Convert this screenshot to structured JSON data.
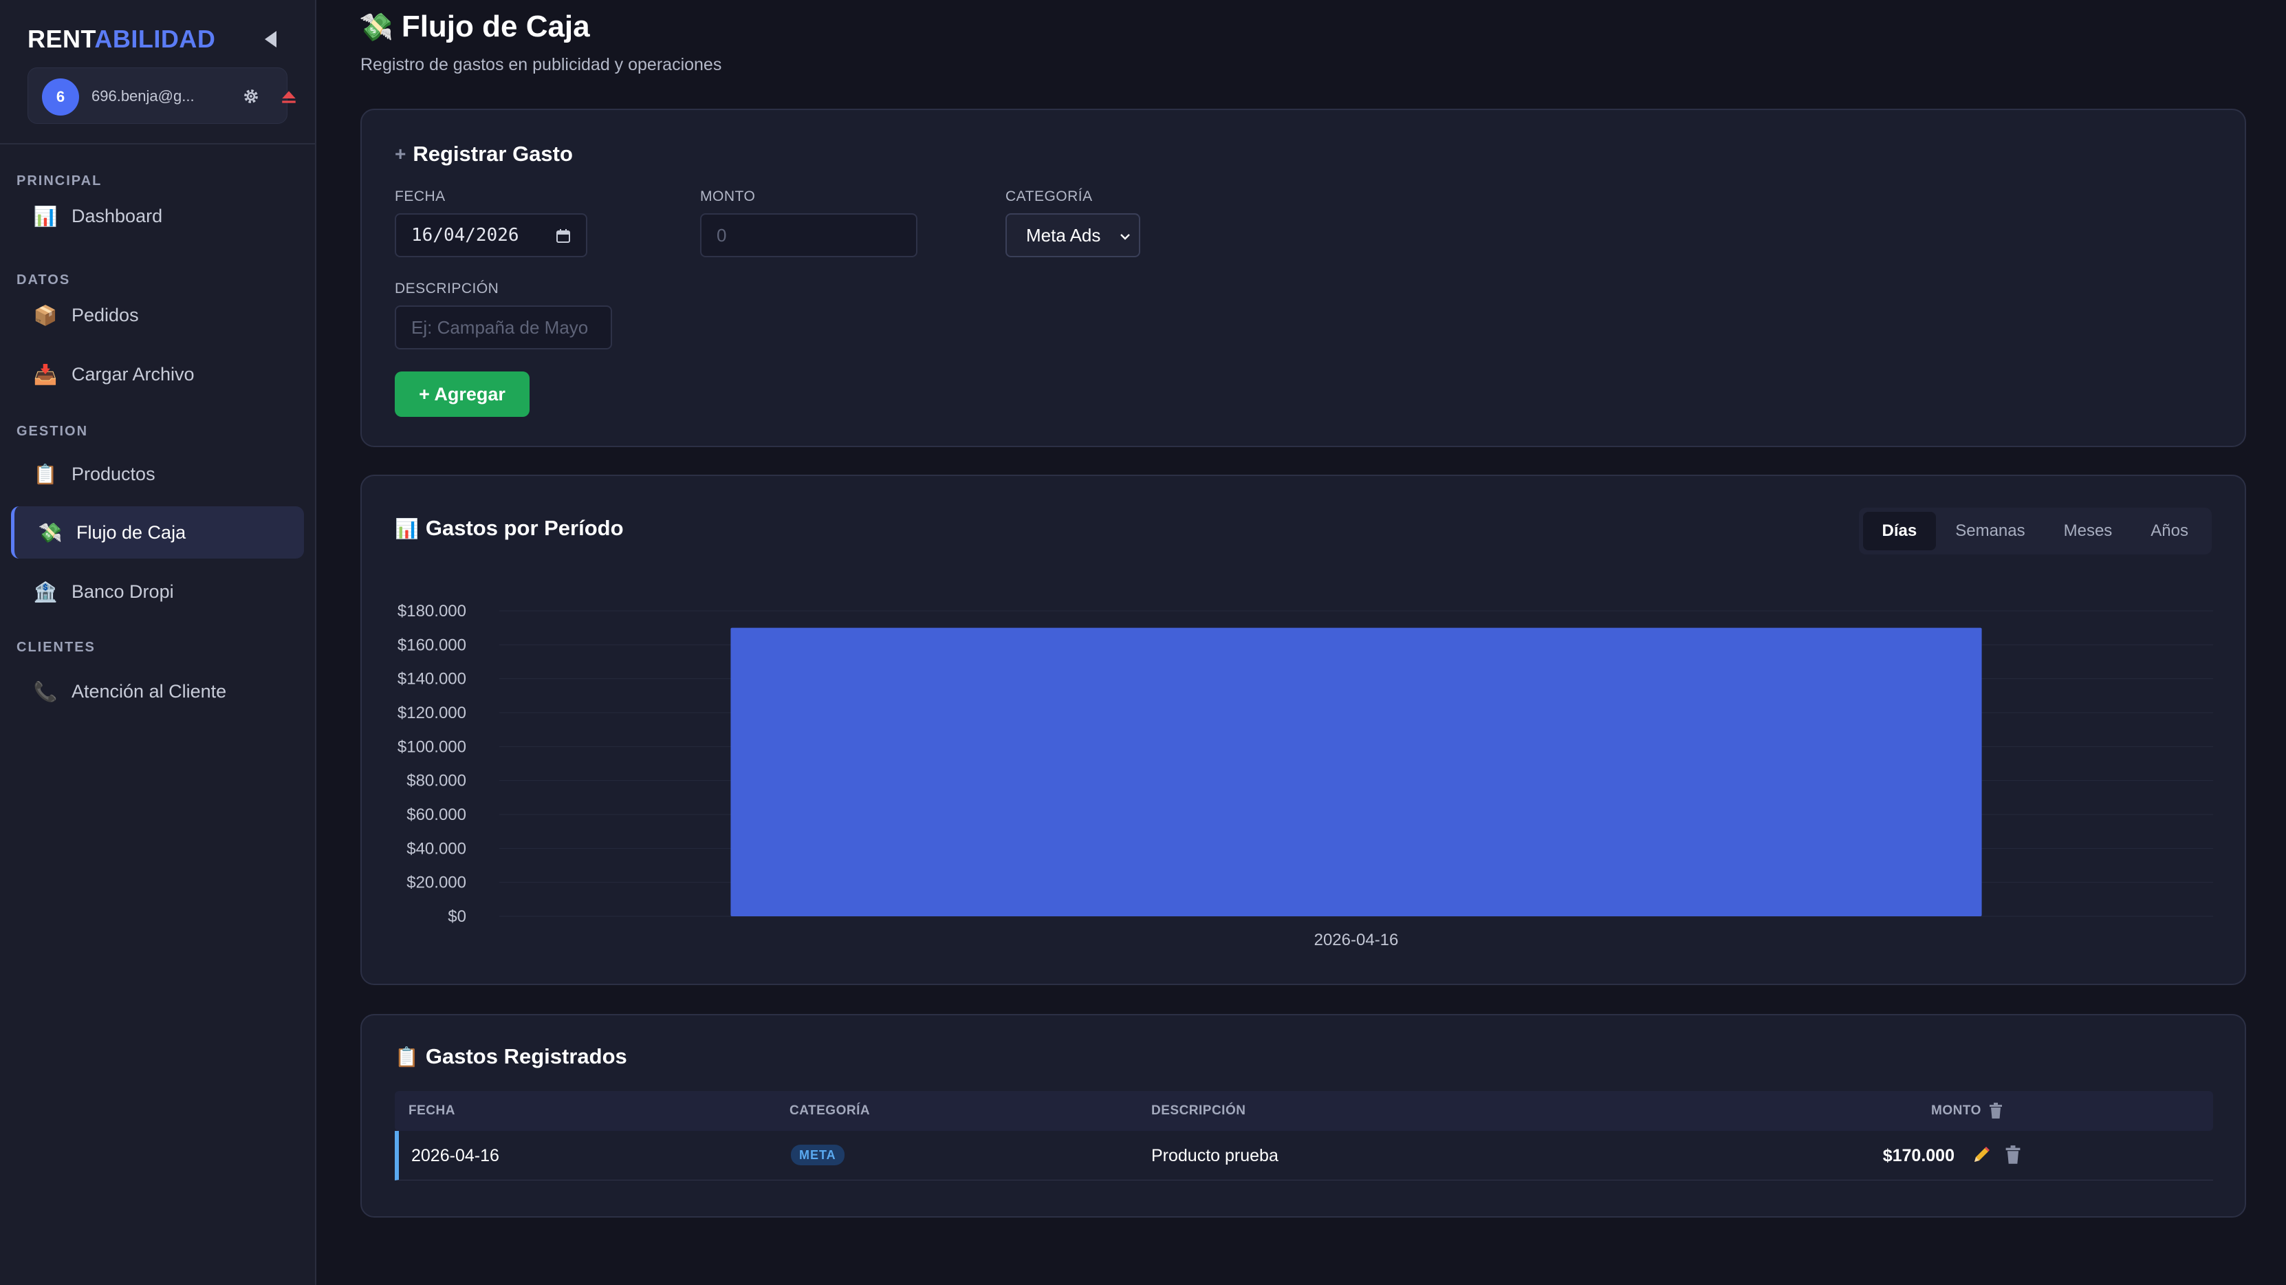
{
  "app": {
    "brand_part1": "RENT",
    "brand_part2": "ABILIDAD",
    "accent_color": "#5b7cf5"
  },
  "user": {
    "avatar_initial": "6",
    "email": "696.benja@g..."
  },
  "sidebar": {
    "sections": {
      "principal": "PRINCIPAL",
      "datos": "DATOS",
      "gestion": "GESTION",
      "clientes": "CLIENTES"
    },
    "items": [
      {
        "label": "Dashboard",
        "icon": "📊",
        "icon_name": "bar-chart-icon"
      },
      {
        "label": "Pedidos",
        "icon": "📦",
        "icon_name": "package-icon"
      },
      {
        "label": "Cargar Archivo",
        "icon": "📥",
        "icon_name": "inbox-tray-icon"
      },
      {
        "label": "Productos",
        "icon": "📋",
        "icon_name": "clipboard-icon"
      },
      {
        "label": "Flujo de Caja",
        "icon": "💸",
        "icon_name": "money-wings-icon",
        "active": true
      },
      {
        "label": "Banco Dropi",
        "icon": "🏦",
        "icon_name": "bank-icon"
      },
      {
        "label": "Atención al Cliente",
        "icon": "📞",
        "icon_name": "phone-icon"
      }
    ]
  },
  "header": {
    "icon": "💸",
    "title": "Flujo de Caja",
    "subtitle": "Registro de gastos en publicidad y operaciones"
  },
  "form": {
    "title_icon": "+",
    "title": "Registrar Gasto",
    "fecha_label": "FECHA",
    "fecha_value": "16/04/2026",
    "monto_label": "MONTO",
    "monto_placeholder": "0",
    "categoria_label": "CATEGORÍA",
    "categoria_value": "Meta Ads",
    "descripcion_label": "DESCRIPCIÓN",
    "descripcion_placeholder": "Ej: Campaña de Mayo",
    "add_button": "+ Agregar"
  },
  "period_chart": {
    "title_icon": "📊",
    "title": "Gastos por Período",
    "tabs": [
      {
        "label": "Días",
        "active": true
      },
      {
        "label": "Semanas"
      },
      {
        "label": "Meses"
      },
      {
        "label": "Años"
      }
    ]
  },
  "chart_data": {
    "type": "bar",
    "categories": [
      "2026-04-16"
    ],
    "values": [
      170000
    ],
    "ylim": [
      0,
      180000
    ],
    "y_ticks": [
      "$0",
      "$20.000",
      "$40.000",
      "$60.000",
      "$80.000",
      "$100.000",
      "$120.000",
      "$140.000",
      "$160.000",
      "$180.000"
    ],
    "y_tick_values": [
      0,
      20000,
      40000,
      60000,
      80000,
      100000,
      120000,
      140000,
      160000,
      180000
    ],
    "bar_color": "#4361d8",
    "grid": true,
    "legend": "none"
  },
  "expenses": {
    "title_icon": "📋",
    "title": "Gastos Registrados",
    "columns": {
      "fecha": "FECHA",
      "categoria": "CATEGORÍA",
      "descripcion": "DESCRIPCIÓN",
      "monto": "MONTO"
    },
    "rows": [
      {
        "fecha": "2026-04-16",
        "categoria": "META",
        "descripcion": "Producto prueba",
        "monto": "$170.000"
      }
    ],
    "badge_color": "#5aa9f0"
  }
}
